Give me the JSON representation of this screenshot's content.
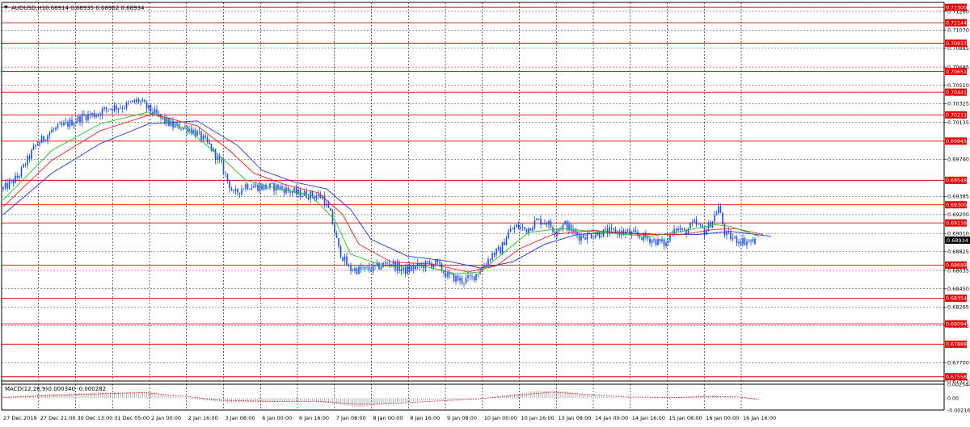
{
  "header": {
    "menu_icon": "triangle-down-icon",
    "symbol_title": "AUDUSD,H1",
    "ohlc": "0.68914 0.68935 0.68962 0.68934"
  },
  "indicator": {
    "label": "MACD(12,26,9)",
    "values": "-0.000340 -0.000282"
  },
  "colors": {
    "background": "#ffffff",
    "grid": "#000000",
    "candles": "#1f4ed8",
    "level_lines": "#e00000",
    "ma_fast": "#22c022",
    "ma_mid": "#e02020",
    "ma_slow": "#2030e0",
    "macd_bars": "#b0b0b0",
    "macd_signal": "#cc0000",
    "price_box": "#000000"
  },
  "chart_data": {
    "type": "candlestick",
    "symbol": "AUDUSD",
    "timeframe": "H1",
    "y_range": [
      0.67515,
      0.7135
    ],
    "price_ticks": [
      "0.71260",
      "0.71070",
      "0.70885",
      "0.70695",
      "0.70510",
      "0.70325",
      "0.70135",
      "0.69760",
      "0.69385",
      "0.69200",
      "0.69010",
      "0.68825",
      "0.68635",
      "0.68450",
      "0.68265",
      "0.68075",
      "0.67700",
      "0.67515"
    ],
    "level_labels": [
      "0.71300",
      "0.71144",
      "0.70937",
      "0.70651",
      "0.70441",
      "0.70211",
      "0.69945",
      "0.69548",
      "0.69300",
      "0.69116",
      "0.68689",
      "0.68354",
      "0.68094",
      "0.67888",
      "0.67558"
    ],
    "current_price": "0.68934",
    "time_labels": [
      "27 Dec 2019",
      "27 Dec 21:00",
      "30 Dec 13:00",
      "31 Dec 05:00",
      "2 Jan 00:00",
      "2 Jan 16:00",
      "3 Jan 08:00",
      "6 Jan 00:00",
      "6 Jan 16:00",
      "7 Jan 08:00",
      "8 Jan 00:00",
      "8 Jan 16:00",
      "9 Jan 08:00",
      "10 Jan 00:00",
      "10 Jan 16:00",
      "13 Jan 08:00",
      "14 Jan 00:00",
      "14 Jan 16:00",
      "15 Jan 08:00",
      "16 Jan 00:00",
      "16 Jan 16:00"
    ],
    "path_points": [
      [
        0,
        0.6946
      ],
      [
        18,
        0.6958
      ],
      [
        40,
        0.699
      ],
      [
        60,
        0.7005
      ],
      [
        80,
        0.7012
      ],
      [
        100,
        0.702
      ],
      [
        115,
        0.7022
      ],
      [
        130,
        0.7028
      ],
      [
        150,
        0.703
      ],
      [
        168,
        0.7036
      ],
      [
        178,
        0.7028
      ],
      [
        195,
        0.7018
      ],
      [
        210,
        0.701
      ],
      [
        228,
        0.7008
      ],
      [
        240,
        0.7002
      ],
      [
        255,
        0.699
      ],
      [
        270,
        0.697
      ],
      [
        285,
        0.694
      ],
      [
        300,
        0.695
      ],
      [
        318,
        0.6948
      ],
      [
        340,
        0.6948
      ],
      [
        362,
        0.6942
      ],
      [
        378,
        0.694
      ],
      [
        395,
        0.6938
      ],
      [
        405,
        0.692
      ],
      [
        415,
        0.6885
      ],
      [
        428,
        0.6865
      ],
      [
        445,
        0.6864
      ],
      [
        460,
        0.6866
      ],
      [
        478,
        0.6872
      ],
      [
        495,
        0.6863
      ],
      [
        515,
        0.6868
      ],
      [
        535,
        0.6871
      ],
      [
        550,
        0.6858
      ],
      [
        568,
        0.6853
      ],
      [
        580,
        0.6856
      ],
      [
        592,
        0.6866
      ],
      [
        605,
        0.688
      ],
      [
        615,
        0.6884
      ],
      [
        625,
        0.6902
      ],
      [
        635,
        0.6908
      ],
      [
        648,
        0.6905
      ],
      [
        660,
        0.6914
      ],
      [
        672,
        0.6913
      ],
      [
        682,
        0.6904
      ],
      [
        695,
        0.691
      ],
      [
        712,
        0.6898
      ],
      [
        730,
        0.69
      ],
      [
        750,
        0.6903
      ],
      [
        770,
        0.6902
      ],
      [
        790,
        0.6898
      ],
      [
        808,
        0.6893
      ],
      [
        820,
        0.689
      ],
      [
        830,
        0.6908
      ],
      [
        842,
        0.6902
      ],
      [
        855,
        0.6911
      ],
      [
        868,
        0.6903
      ],
      [
        878,
        0.6915
      ],
      [
        885,
        0.6928
      ],
      [
        893,
        0.69
      ],
      [
        905,
        0.6895
      ],
      [
        918,
        0.6893
      ],
      [
        930,
        0.6893
      ]
    ],
    "ma_fast_points": [
      [
        0,
        0.6935
      ],
      [
        60,
        0.6985
      ],
      [
        120,
        0.7012
      ],
      [
        180,
        0.7024
      ],
      [
        230,
        0.7005
      ],
      [
        270,
        0.6978
      ],
      [
        300,
        0.6955
      ],
      [
        340,
        0.6946
      ],
      [
        380,
        0.694
      ],
      [
        410,
        0.6915
      ],
      [
        430,
        0.688
      ],
      [
        470,
        0.6868
      ],
      [
        520,
        0.6868
      ],
      [
        560,
        0.686
      ],
      [
        590,
        0.6862
      ],
      [
        620,
        0.6882
      ],
      [
        650,
        0.6902
      ],
      [
        690,
        0.6906
      ],
      [
        740,
        0.6902
      ],
      [
        800,
        0.6898
      ],
      [
        840,
        0.6903
      ],
      [
        880,
        0.691
      ],
      [
        900,
        0.6908
      ],
      [
        935,
        0.6898
      ]
    ],
    "ma_mid_points": [
      [
        0,
        0.6928
      ],
      [
        60,
        0.6975
      ],
      [
        120,
        0.7005
      ],
      [
        185,
        0.7022
      ],
      [
        240,
        0.701
      ],
      [
        280,
        0.6985
      ],
      [
        310,
        0.6962
      ],
      [
        350,
        0.695
      ],
      [
        390,
        0.6942
      ],
      [
        420,
        0.692
      ],
      [
        440,
        0.689
      ],
      [
        480,
        0.6872
      ],
      [
        530,
        0.687
      ],
      [
        575,
        0.6862
      ],
      [
        610,
        0.6868
      ],
      [
        640,
        0.6886
      ],
      [
        680,
        0.69
      ],
      [
        730,
        0.6904
      ],
      [
        790,
        0.69
      ],
      [
        840,
        0.69
      ],
      [
        880,
        0.6905
      ],
      [
        905,
        0.6906
      ],
      [
        940,
        0.69
      ]
    ],
    "ma_slow_points": [
      [
        0,
        0.692
      ],
      [
        60,
        0.6962
      ],
      [
        120,
        0.6992
      ],
      [
        180,
        0.7012
      ],
      [
        240,
        0.7015
      ],
      [
        290,
        0.699
      ],
      [
        320,
        0.6965
      ],
      [
        360,
        0.6953
      ],
      [
        400,
        0.6946
      ],
      [
        430,
        0.6925
      ],
      [
        455,
        0.6895
      ],
      [
        500,
        0.6878
      ],
      [
        550,
        0.6873
      ],
      [
        590,
        0.6866
      ],
      [
        630,
        0.6872
      ],
      [
        670,
        0.689
      ],
      [
        710,
        0.69
      ],
      [
        760,
        0.6902
      ],
      [
        810,
        0.69
      ],
      [
        860,
        0.69
      ],
      [
        900,
        0.6903
      ],
      [
        950,
        0.6898
      ]
    ],
    "macd": {
      "range": [
        -0.00216,
        0.002544
      ],
      "ticks": [
        "0.002544",
        "0.00",
        "-0.00216"
      ],
      "histogram_points": [
        [
          0,
          0.0002
        ],
        [
          40,
          0.0006
        ],
        [
          90,
          0.0009
        ],
        [
          140,
          0.0011
        ],
        [
          180,
          0.0012
        ],
        [
          200,
          0.0006
        ],
        [
          240,
          -0.0003
        ],
        [
          280,
          -0.0008
        ],
        [
          330,
          -0.0007
        ],
        [
          380,
          -0.0005
        ],
        [
          410,
          -0.001
        ],
        [
          440,
          -0.0017
        ],
        [
          470,
          -0.0011
        ],
        [
          520,
          -0.0004
        ],
        [
          570,
          -0.0003
        ],
        [
          600,
          0.0001
        ],
        [
          640,
          0.0009
        ],
        [
          660,
          0.0014
        ],
        [
          690,
          0.0013
        ],
        [
          720,
          0.0006
        ],
        [
          760,
          0.0001
        ],
        [
          800,
          0.0
        ],
        [
          840,
          0.0002
        ],
        [
          880,
          0.0005
        ],
        [
          910,
          0.0
        ],
        [
          930,
          -0.0003
        ]
      ],
      "signal_points": [
        [
          0,
          0.0001
        ],
        [
          60,
          0.0005
        ],
        [
          120,
          0.0008
        ],
        [
          175,
          0.001
        ],
        [
          220,
          0.0004
        ],
        [
          270,
          -0.0004
        ],
        [
          330,
          -0.0006
        ],
        [
          390,
          -0.0006
        ],
        [
          440,
          -0.0011
        ],
        [
          490,
          -0.0009
        ],
        [
          540,
          -0.0005
        ],
        [
          590,
          -0.0001
        ],
        [
          640,
          0.0006
        ],
        [
          680,
          0.0011
        ],
        [
          720,
          0.0007
        ],
        [
          770,
          0.0002
        ],
        [
          830,
          0.0001
        ],
        [
          880,
          0.0003
        ],
        [
          910,
          0.0002
        ],
        [
          935,
          -0.0002
        ]
      ]
    }
  }
}
